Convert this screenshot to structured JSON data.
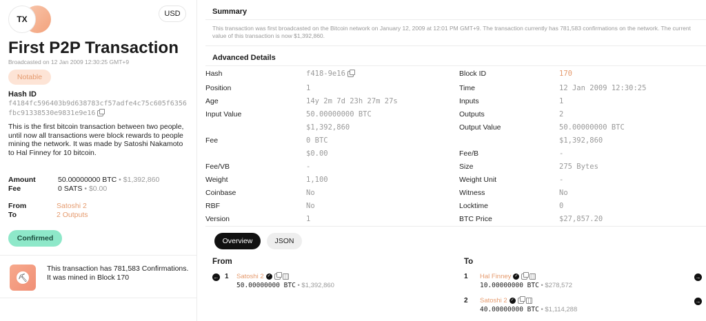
{
  "header": {
    "badge": "TX",
    "currency": "USD",
    "title": "First P2P Transaction",
    "broadcasted": "Broadcasted on 12 Jan 2009 12:30:25 GMT+9",
    "tag": "Notable"
  },
  "hash": {
    "label": "Hash ID",
    "value": "f4184fc596403b9d638783cf57adfe4c75c605f6356fbc91338530e9831e9e16"
  },
  "description": "This is the first bitcoin transaction between two people, until now all transactions were block rewards to people mining the network. It was made by Satoshi Nakamoto to Hal Finney for 10 bitcoin.",
  "amounts": {
    "amount_label": "Amount",
    "amount_btc": "50.00000000 BTC",
    "amount_usd": "$1,392,860",
    "fee_label": "Fee",
    "fee_sats": "0 SATS",
    "fee_usd": "$0.00"
  },
  "parties": {
    "from_label": "From",
    "from_value": "Satoshi 2",
    "to_label": "To",
    "to_value": "2 Outputs"
  },
  "status": "Confirmed",
  "mined": "This transaction has 781,583 Confirmations. It was mined in Block 170",
  "summary": {
    "title": "Summary",
    "text": "This transaction was first broadcasted on the Bitcoin network on January 12, 2009 at 12:01 PM GMT+9. The transaction currently has 781,583 confirmations on the network. The current value of this transaction is now $1,392,860."
  },
  "advanced": {
    "title": "Advanced Details",
    "left": [
      {
        "label": "Hash",
        "value": "f418-9e16"
      },
      {
        "label": "Position",
        "value": "1"
      },
      {
        "label": "Age",
        "value": "14y 2m 7d 23h 27m 27s"
      },
      {
        "label": "Input Value",
        "value": "50.00000000 BTC",
        "value2": "$1,392,860"
      },
      {
        "label": "Fee",
        "value": "0 BTC",
        "value2": "$0.00"
      },
      {
        "label": "Fee/VB",
        "value": "-"
      },
      {
        "label": "Weight",
        "value": "1,100"
      },
      {
        "label": "Coinbase",
        "value": "No"
      },
      {
        "label": "RBF",
        "value": "No"
      },
      {
        "label": "Version",
        "value": "1"
      }
    ],
    "right": [
      {
        "label": "Block ID",
        "value": "170"
      },
      {
        "label": "Time",
        "value": "12 Jan 2009 12:30:25"
      },
      {
        "label": "Inputs",
        "value": "1"
      },
      {
        "label": "Outputs",
        "value": "2"
      },
      {
        "label": "Output Value",
        "value": "50.00000000 BTC",
        "value2": "$1,392,860"
      },
      {
        "label": "Fee/B",
        "value": "-"
      },
      {
        "label": "Size",
        "value": "275 Bytes"
      },
      {
        "label": "Weight Unit",
        "value": "-"
      },
      {
        "label": "Witness",
        "value": "No"
      },
      {
        "label": "Locktime",
        "value": "0"
      },
      {
        "label": "BTC Price",
        "value": "$27,857.20"
      }
    ]
  },
  "tabs": [
    "Overview",
    "JSON"
  ],
  "io": {
    "from_title": "From",
    "to_title": "To",
    "inputs": [
      {
        "index": "1",
        "name": "Satoshi 2",
        "btc": "50.00000000 BTC",
        "usd": "$1,392,860"
      }
    ],
    "outputs": [
      {
        "index": "1",
        "name": "Hal Finney",
        "btc": "10.00000000 BTC",
        "usd": "$278,572"
      },
      {
        "index": "2",
        "name": "Satoshi 2",
        "btc": "40.00000000 BTC",
        "usd": "$1,114,288"
      }
    ]
  },
  "separator": "•",
  "colors": {
    "accent": "#e59a6d",
    "confirmed": "#8ee8c9",
    "notable_bg": "#fde4d6"
  }
}
